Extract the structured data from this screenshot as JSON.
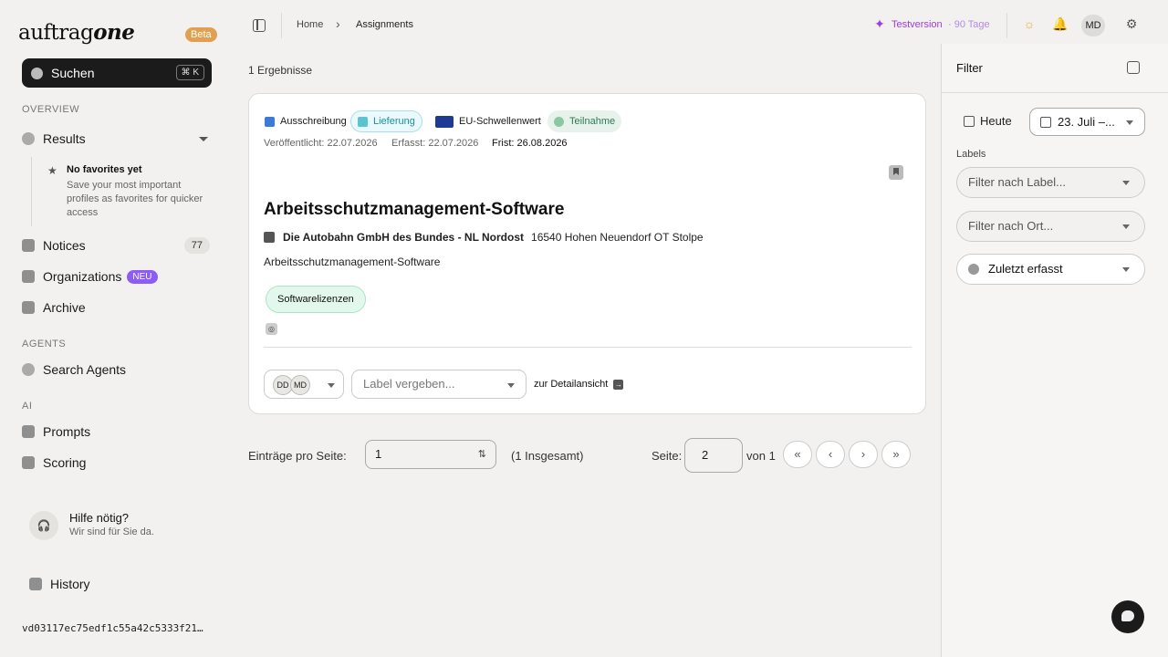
{
  "sidebar": {
    "logo_plain": "auftrag",
    "logo_bold": "one",
    "beta": "Beta",
    "search_label": "Suchen",
    "search_shortcut": "⌘ K",
    "overview_label": "OVERVIEW",
    "results": "Results",
    "fav_title": "No favorites yet",
    "fav_text": "Save your most important profiles as favorites for quicker access",
    "notices": "Notices",
    "notices_count": "77",
    "organizations": "Organizations",
    "neu": "NEU",
    "archive": "Archive",
    "agents_label": "AGENTS",
    "search_agents": "Search Agents",
    "ai_label": "AI",
    "prompts": "Prompts",
    "scoring": "Scoring",
    "help_title": "Hilfe nötig?",
    "help_sub": "Wir sind für Sie da.",
    "history": "History",
    "hash": "vd03117ec75edf1c55a42c5333f21…"
  },
  "topbar": {
    "crumb_home": "Home",
    "crumb_current": "Assignments",
    "trial": "Testversion",
    "trial_days": "· 90 Tage",
    "user_initials": "MD"
  },
  "main": {
    "results_count": "1 Ergebnisse",
    "card": {
      "tags": [
        "Ausschreibung",
        "Lieferung",
        "EU-Schwellenwert",
        "Teilnahme"
      ],
      "published": "Veröffentlicht: 22.07.2026",
      "captured": "Erfasst: 22.07.2026",
      "deadline": "Frist: 26.08.2026",
      "title": "Arbeitsschutzmanagement-Software",
      "org": "Die Autobahn GmbH des Bundes - NL Nordost",
      "location": "16540 Hohen Neuendorf OT Stolpe",
      "description": "Arbeitsschutzmanagement-Software",
      "chip": "Softwarelizenzen",
      "assignees": [
        "DD",
        "MD"
      ],
      "label_placeholder": "Label vergeben...",
      "detail_link": "zur Detailansicht"
    },
    "pager": {
      "per_page_label": "Einträge pro Seite:",
      "per_page_value": "1",
      "total": "(1 Insgesamt)",
      "page_label": "Seite:",
      "page_value": "2",
      "of": "von 1",
      "first": "«",
      "prev": "‹",
      "next": "›",
      "last": "»"
    }
  },
  "filter": {
    "title": "Filter",
    "today": "Heute",
    "date_range": "23. Juli –...",
    "labels_label": "Labels",
    "label_filter": "Filter nach Label...",
    "location_filter": "Filter nach Ort...",
    "sort": "Zuletzt erfasst"
  },
  "colors": {
    "accent": "#1b1b1b",
    "trial": "#9b3de0",
    "neu_badge": "#8b5cf6",
    "beta_badge": "#e0a050",
    "chip_bg": "#e3f8ec"
  }
}
